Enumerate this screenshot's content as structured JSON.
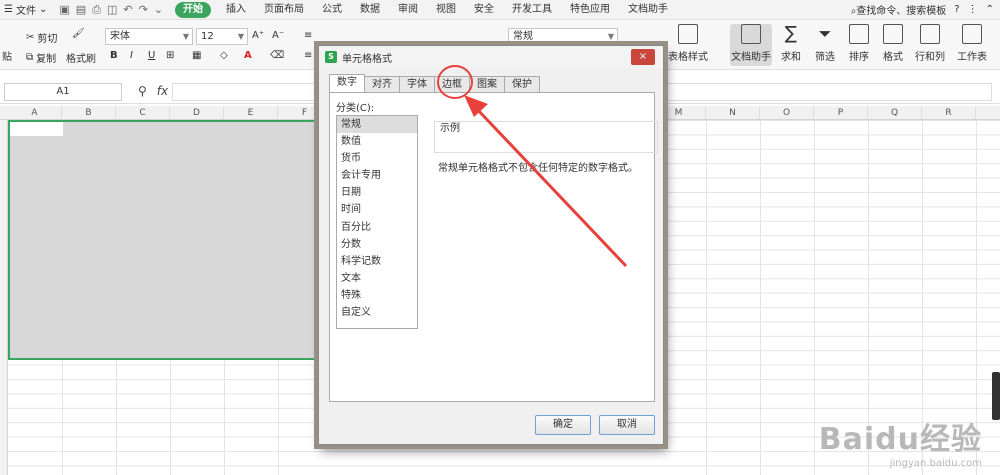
{
  "menubar": {
    "file_label": "文件",
    "tabs": [
      {
        "label": "开始",
        "active": true
      },
      {
        "label": "插入"
      },
      {
        "label": "页面布局"
      },
      {
        "label": "公式"
      },
      {
        "label": "数据"
      },
      {
        "label": "审阅"
      },
      {
        "label": "视图"
      },
      {
        "label": "安全"
      },
      {
        "label": "开发工具"
      },
      {
        "label": "特色应用"
      },
      {
        "label": "文档助手"
      }
    ],
    "search_label": "查找命令、搜索模板",
    "help": "?"
  },
  "ribbon": {
    "paste": "贴",
    "cut": "剪切",
    "copy": "复制",
    "format_painter": "格式刷",
    "font_name": "宋体",
    "font_size": "12",
    "bold": "B",
    "italic": "I",
    "underline": "U",
    "font_color": "A",
    "number_format": "常规",
    "table_style": "表格样式",
    "doc_assistant": "文档助手",
    "sum": "求和",
    "filter": "筛选",
    "sort": "排序",
    "format": "格式",
    "row_col": "行和列",
    "worksheet": "工作表"
  },
  "formula_bar": {
    "cell_ref": "A1",
    "fx": "fx",
    "value": ""
  },
  "columns": [
    "A",
    "B",
    "C",
    "D",
    "E",
    "F",
    "M",
    "N",
    "O",
    "P",
    "Q",
    "R"
  ],
  "dialog": {
    "title": "单元格格式",
    "close": "×",
    "tabs": [
      {
        "label": "数字",
        "active": true
      },
      {
        "label": "对齐"
      },
      {
        "label": "字体"
      },
      {
        "label": "边框"
      },
      {
        "label": "图案"
      },
      {
        "label": "保护"
      }
    ],
    "category_label": "分类(C):",
    "categories": [
      "常规",
      "数值",
      "货币",
      "会计专用",
      "日期",
      "时间",
      "百分比",
      "分数",
      "科学记数",
      "文本",
      "特殊",
      "自定义"
    ],
    "selected_category": "常规",
    "sample_label": "示例",
    "description": "常规单元格格式不包含任何特定的数字格式。",
    "ok": "确定",
    "cancel": "取消"
  },
  "colors": {
    "accent_green": "#3ba55d",
    "annotation_red": "#e8403a"
  },
  "watermark": {
    "brand": "Baidu经验",
    "url": "jingyan.baidu.com"
  }
}
